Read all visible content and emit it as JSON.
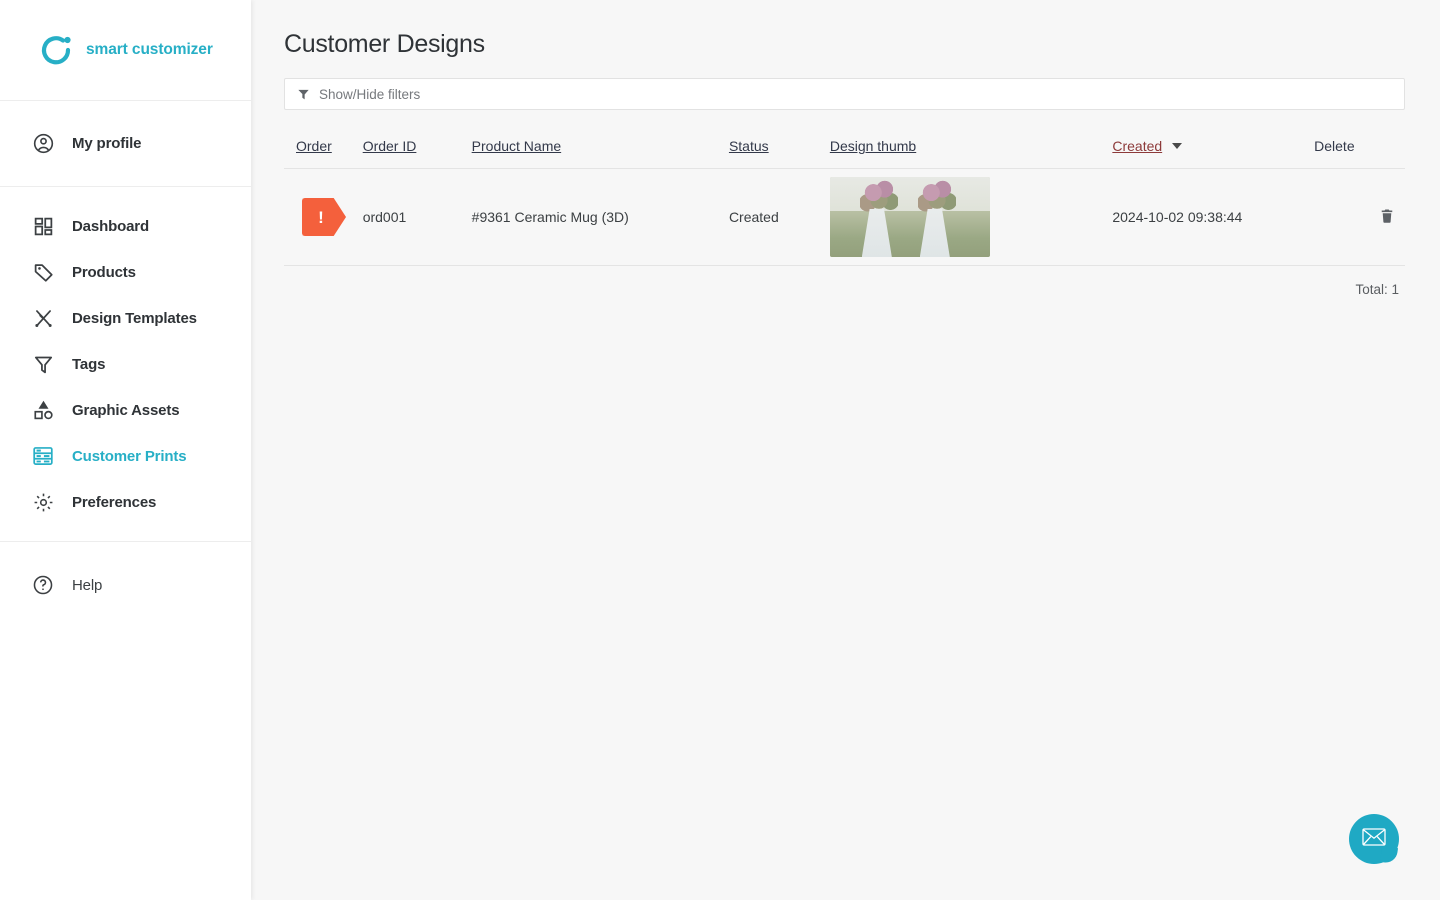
{
  "brand": {
    "name": "smart customizer",
    "logo_icon": "circle-dot-logo-icon",
    "accent_color": "#27afc6"
  },
  "sidebar": {
    "profile": {
      "label": "My profile",
      "icon": "user-circle-icon"
    },
    "items": [
      {
        "label": "Dashboard",
        "icon": "dashboard-grid-icon",
        "active": false
      },
      {
        "label": "Products",
        "icon": "tag-icon",
        "active": false
      },
      {
        "label": "Design Templates",
        "icon": "design-tools-icon",
        "active": false
      },
      {
        "label": "Tags",
        "icon": "funnel-icon",
        "active": false
      },
      {
        "label": "Graphic Assets",
        "icon": "shapes-icon",
        "active": false
      },
      {
        "label": "Customer Prints",
        "icon": "printer-icon",
        "active": true
      },
      {
        "label": "Preferences",
        "icon": "gear-icon",
        "active": false
      }
    ],
    "help": {
      "label": "Help",
      "icon": "question-circle-icon"
    }
  },
  "page": {
    "title": "Customer Designs"
  },
  "filters": {
    "label": "Show/Hide filters",
    "icon": "funnel-filter-icon"
  },
  "table": {
    "columns": [
      {
        "label": "Order",
        "sortable": true,
        "sorted": false
      },
      {
        "label": "Order ID",
        "sortable": true,
        "sorted": false
      },
      {
        "label": "Product Name",
        "sortable": true,
        "sorted": false
      },
      {
        "label": "Status",
        "sortable": true,
        "sorted": false
      },
      {
        "label": "Design thumb",
        "sortable": true,
        "sorted": false
      },
      {
        "label": "Created",
        "sortable": true,
        "sorted": true,
        "sort_direction": "desc"
      },
      {
        "label": "Delete",
        "sortable": false,
        "sorted": false
      }
    ],
    "rows": [
      {
        "order_badge": "!",
        "order_badge_color": "#f4603c",
        "order_id": "ord001",
        "product_name": "#9361 Ceramic Mug (3D)",
        "status": "Created",
        "thumb_alt": "two-women-holding-flower-bouquets-in-field",
        "created": "2024-10-02 09:38:44",
        "delete_icon": "trash-icon"
      }
    ],
    "total_label": "Total: 1"
  },
  "chat": {
    "icon": "envelope-icon",
    "color": "#1fa9c4"
  }
}
